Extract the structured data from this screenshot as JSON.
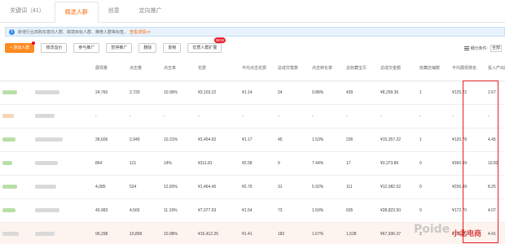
{
  "tabs": [
    {
      "label": "关键词（41）",
      "active": false
    },
    {
      "label": "精选人群",
      "active": true
    },
    {
      "label": "创意",
      "active": false
    },
    {
      "label": "定向推广",
      "active": false
    }
  ],
  "notice": {
    "text": "新增行业高购买意向人群、跨境目标人群、推荐人群等标签，",
    "link": "查看详情>>"
  },
  "toolbar": {
    "add_crowd": "+ 添加人群",
    "modify_bid": "修改溢价",
    "join_promotion": "参与推广",
    "pause_promotion": "暂停推广",
    "delete": "删除",
    "copy": "复制",
    "optimize": "优质人群扩展",
    "new_badge": "NEW",
    "field_settings": "细分条件:",
    "field_select": "全部"
  },
  "table": {
    "headers": [
      "",
      "",
      "展现量",
      "点击量",
      "点击率",
      "花费",
      "平均点击花费",
      "总成交笔数",
      "点击转化率",
      "总收藏宝贝",
      "总成交金额",
      "收藏店铺数",
      "平均展现排名",
      "投入产出比"
    ],
    "rows": [
      [
        "24,760",
        "2,720",
        "10.99%",
        "¥3,103.22",
        "¥1.14",
        "24",
        "0.88%",
        "439",
        "¥8,299.36",
        "1",
        "¥125.22",
        "2.67"
      ],
      [
        "-",
        "-",
        "-",
        "-",
        "-",
        "-",
        "-",
        "-",
        "-",
        "-",
        "-",
        "-"
      ],
      [
        "28,606",
        "2,949",
        "10.31%",
        "¥3,454.92",
        "¥1.17",
        "45",
        "1.53%",
        "236",
        "¥15,357.22",
        "1",
        "¥120.78",
        "4.45"
      ],
      [
        "864",
        "121",
        "14%",
        "¥311.81",
        "¥2.58",
        "9",
        "7.44%",
        "17",
        "¥3,373.86",
        "0",
        "¥360.89",
        "10.82"
      ],
      [
        "4,085",
        "524",
        "12.83%",
        "¥1,464.45",
        "¥2.79",
        "31",
        "5.92%",
        "111",
        "¥12,082.52",
        "0",
        "¥256.49",
        "8.25"
      ],
      [
        "40,983",
        "4,565",
        "11.19%",
        "¥7,077.93",
        "¥1.54",
        "73",
        "1.59%",
        "635",
        "¥28,823.50",
        "0",
        "¥172.70",
        "4.07"
      ],
      [
        "99,298",
        "10,899",
        "10.98%",
        "¥15,412.25",
        "¥1.41",
        "182",
        "1.67%",
        "1,538",
        "¥67,936.37",
        "2",
        "¥155.20",
        "4.41"
      ]
    ]
  },
  "watermark": "Poide",
  "stamp": "小北电商",
  "colors": {
    "accent": "#ff6600",
    "highlight_box": "#e02020",
    "notice_bg": "#e8f2fc"
  }
}
